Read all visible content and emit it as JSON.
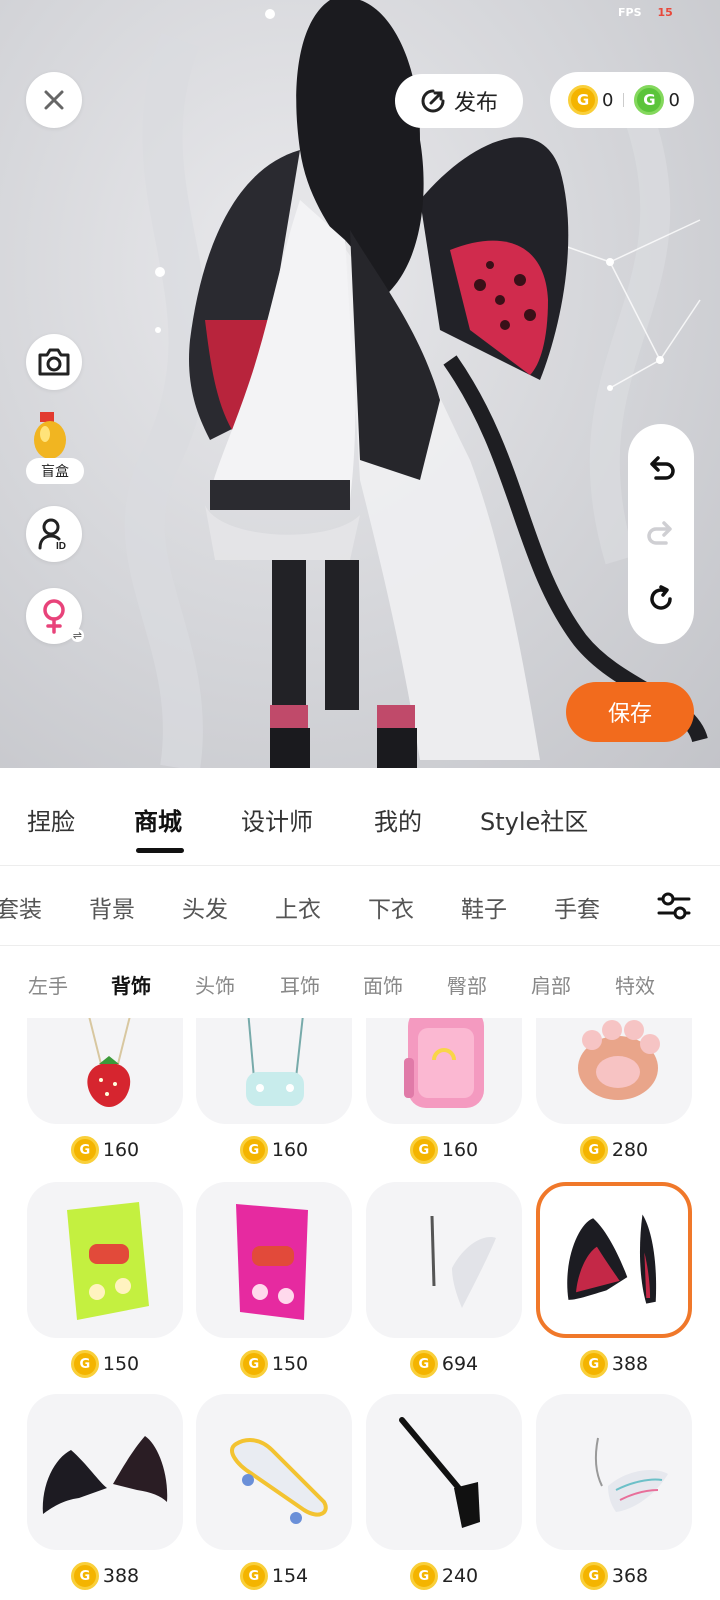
{
  "status": {
    "fps_label": "FPS",
    "fps_value": "15"
  },
  "viewport": {
    "publish_label": "发布",
    "gold_balance": "0",
    "green_balance": "0",
    "blindbox_label": "盲盒",
    "save_label": "保存"
  },
  "main_tabs": [
    "捏脸",
    "商城",
    "设计师",
    "我的",
    "Style社区"
  ],
  "category_tabs": [
    "套装",
    "背景",
    "头发",
    "上衣",
    "下衣",
    "鞋子",
    "手套"
  ],
  "sub_tabs": [
    "左手",
    "背饰",
    "头饰",
    "耳饰",
    "面饰",
    "臀部",
    "肩部",
    "特效"
  ],
  "items": [
    {
      "price": "160",
      "icon": "strawberry-bag-icon"
    },
    {
      "price": "160",
      "icon": "gamepad-bag-icon"
    },
    {
      "price": "160",
      "icon": "pink-backpack-icon"
    },
    {
      "price": "280",
      "icon": "paw-icon"
    },
    {
      "price": "150",
      "icon": "green-chips-icon"
    },
    {
      "price": "150",
      "icon": "pink-chips-icon"
    },
    {
      "price": "694",
      "icon": "white-wing-icon"
    },
    {
      "price": "388",
      "icon": "red-devil-wings-icon",
      "selected": true
    },
    {
      "price": "388",
      "icon": "black-bat-wings-icon"
    },
    {
      "price": "154",
      "icon": "skateboard-icon"
    },
    {
      "price": "240",
      "icon": "black-sling-bag-icon"
    },
    {
      "price": "368",
      "icon": "feather-wing-icon"
    }
  ],
  "colors": {
    "accent": "#f26b1d",
    "selected_border": "#f0782a",
    "gold_coin": "#f4b400",
    "green_coin": "#5bc43a"
  }
}
